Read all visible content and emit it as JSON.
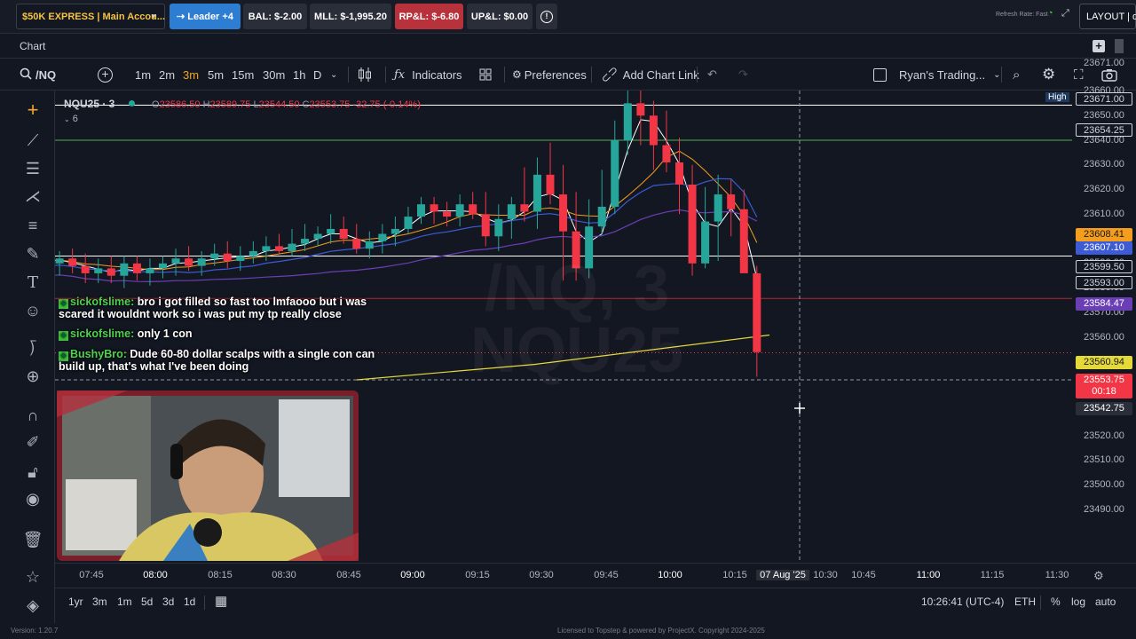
{
  "topbar": {
    "account": "$50K EXPRESS | Main Accou...",
    "leader": "Leader +4",
    "bal": "BAL: $-2.00",
    "mll": "MLL: $-1,995.20",
    "rpl": "RP&L: $-6.80",
    "upl": "UP&L: $0.00",
    "refresh": "Refresh Rate: Fast",
    "layout": "LAYOUT | de"
  },
  "panel": {
    "title": "Chart"
  },
  "toolbar": {
    "symbol": "/NQ",
    "timeframes": [
      "1m",
      "2m",
      "3m",
      "5m",
      "15m",
      "30m",
      "1h",
      "D"
    ],
    "active_timeframe": "3m",
    "indicators": "Indicators",
    "preferences": "Preferences",
    "add_chart_link": "Add Chart Link",
    "template": "Ryan's Trading..."
  },
  "legend": {
    "symbol": "NQU25 · 3",
    "o_label": "O",
    "o": "23586.50",
    "h_label": "H",
    "h": "23589.75",
    "l_label": "L",
    "l": "23544.50",
    "c_label": "C",
    "c": "23553.75",
    "change": "-32.75 (-0.14%)",
    "collapsed": "6"
  },
  "watermark": {
    "line1": "/NQ, 3",
    "line2": "NQU25"
  },
  "chat": [
    {
      "user": "sickofslime:",
      "text": "bro i got filled so fast too lmfaooo but i was scared it wouldnt work so i was put my tp really close"
    },
    {
      "user": "sickofslime:",
      "text": "only 1 con"
    },
    {
      "user": "BushyBro:",
      "text": "Dude 60-80 dollar scalps with a single con can build up, that's what I've been doing"
    }
  ],
  "price_axis": {
    "ticks": [
      "23671.00",
      "23660.00",
      "23650.00",
      "23640.00",
      "23630.00",
      "23620.00",
      "23610.00",
      "23600.00",
      "23590.00",
      "23580.00",
      "23570.00",
      "23560.00",
      "23550.00",
      "23540.00",
      "23530.00",
      "23520.00",
      "23510.00",
      "23500.00",
      "23490.00"
    ],
    "high_label": "High",
    "labels": [
      {
        "text": "23671.00",
        "bg": "#131722",
        "fg": "#d1d4dc"
      },
      {
        "text": "23654.25",
        "bg": "#131722",
        "fg": "#d1d4dc"
      },
      {
        "text": "23608.41",
        "bg": "#f59d1c",
        "fg": "#131722"
      },
      {
        "text": "23607.10",
        "bg": "#3c5bd4",
        "fg": "#ffffff"
      },
      {
        "text": "23599.50",
        "bg": "#131722",
        "fg": "#d1d4dc"
      },
      {
        "text": "23593.00",
        "bg": "#131722",
        "fg": "#d1d4dc"
      },
      {
        "text": "23584.47",
        "bg": "#6a3fb5",
        "fg": "#ffffff"
      },
      {
        "text": "23560.94",
        "bg": "#e5d93a",
        "fg": "#131722"
      },
      {
        "text": "23553.75",
        "bg": "#f23645",
        "fg": "#ffffff"
      },
      {
        "text": "00:18",
        "bg": "#f23645",
        "fg": "#ffffff"
      },
      {
        "text": "23542.75",
        "bg": "#2a2e39",
        "fg": "#ffffff"
      }
    ]
  },
  "time_axis": {
    "labels": [
      "07:45",
      "08:00",
      "08:15",
      "08:30",
      "08:45",
      "09:00",
      "09:15",
      "09:30",
      "09:45",
      "10:00",
      "10:15",
      "07 Aug '25",
      "10:30",
      "10:45",
      "11:00",
      "11:15",
      "11:30"
    ]
  },
  "bottom": {
    "ranges": [
      "1yr",
      "3m",
      "1m",
      "5d",
      "3d",
      "1d"
    ],
    "clock": "10:26:41 (UTC-4)",
    "session": "ETH",
    "percent": "%",
    "log": "log",
    "auto": "auto"
  },
  "footer": {
    "version": "Version: 1.20.7",
    "license": "Licensed to Topstep & powered by ProjectX. Copyright 2024-2025"
  },
  "chart_data": {
    "type": "candlestick",
    "symbol": "NQU25",
    "ylim": [
      23485,
      23675
    ],
    "x": [
      "07:45",
      "07:48",
      "07:51",
      "07:54",
      "07:57",
      "08:00",
      "08:03",
      "08:06",
      "08:09",
      "08:12",
      "08:15",
      "08:18",
      "08:21",
      "08:24",
      "08:27",
      "08:30",
      "08:33",
      "08:36",
      "08:39",
      "08:42",
      "08:45",
      "08:48",
      "08:51",
      "08:54",
      "08:57",
      "09:00",
      "09:03",
      "09:06",
      "09:09",
      "09:12",
      "09:15",
      "09:18",
      "09:21",
      "09:24",
      "09:27",
      "09:30",
      "09:33",
      "09:36",
      "09:39",
      "09:42",
      "09:45",
      "09:48",
      "09:51",
      "09:54",
      "09:57",
      "10:00",
      "10:03",
      "10:06",
      "10:09",
      "10:12",
      "10:15",
      "10:18",
      "10:21",
      "10:24"
    ],
    "open": [
      23596,
      23592,
      23590,
      23592,
      23589,
      23586,
      23588,
      23585,
      23590,
      23586,
      23588,
      23590,
      23592,
      23589,
      23592,
      23594,
      23591,
      23593,
      23595,
      23597,
      23595,
      23598,
      23600,
      23602,
      23604,
      23600,
      23596,
      23599,
      23602,
      23604,
      23609,
      23614,
      23611,
      23609,
      23614,
      23610,
      23601,
      23608,
      23614,
      23611,
      23626,
      23618,
      23603,
      23588,
      23605,
      23613,
      23640,
      23655,
      23650,
      23638,
      23631,
      23622,
      23590,
      23607,
      23618,
      23612,
      23586
    ],
    "high": [
      23600,
      23596,
      23595,
      23596,
      23594,
      23592,
      23593,
      23593,
      23593,
      23592,
      23593,
      23596,
      23597,
      23595,
      23598,
      23599,
      23597,
      23599,
      23601,
      23602,
      23604,
      23606,
      23605,
      23610,
      23609,
      23606,
      23603,
      23606,
      23609,
      23613,
      23617,
      23617,
      23615,
      23618,
      23619,
      23619,
      23614,
      23617,
      23629,
      23633,
      23639,
      23630,
      23619,
      23616,
      23628,
      23648,
      23661,
      23666,
      23656,
      23652,
      23641,
      23630,
      23621,
      23626,
      23624,
      23620,
      23589
    ],
    "low": [
      23588,
      23587,
      23585,
      23586,
      23582,
      23582,
      23582,
      23580,
      23583,
      23581,
      23584,
      23585,
      23587,
      23585,
      23589,
      23588,
      23587,
      23590,
      23591,
      23594,
      23593,
      23595,
      23597,
      23598,
      23598,
      23594,
      23592,
      23594,
      23597,
      23602,
      23606,
      23606,
      23605,
      23605,
      23608,
      23597,
      23595,
      23600,
      23607,
      23604,
      23614,
      23583,
      23583,
      23584,
      23602,
      23610,
      23634,
      23638,
      23628,
      23627,
      23610,
      23585,
      23588,
      23591,
      23601,
      23587,
      23544
    ],
    "close": [
      23592,
      23590,
      23592,
      23589,
      23586,
      23588,
      23585,
      23590,
      23586,
      23588,
      23590,
      23592,
      23589,
      23592,
      23594,
      23591,
      23593,
      23595,
      23597,
      23595,
      23598,
      23600,
      23602,
      23604,
      23600,
      23596,
      23599,
      23602,
      23604,
      23609,
      23614,
      23611,
      23609,
      23614,
      23610,
      23601,
      23608,
      23614,
      23611,
      23626,
      23618,
      23603,
      23588,
      23605,
      23613,
      23640,
      23655,
      23650,
      23638,
      23631,
      23622,
      23590,
      23607,
      23618,
      23612,
      23586,
      23554
    ]
  }
}
